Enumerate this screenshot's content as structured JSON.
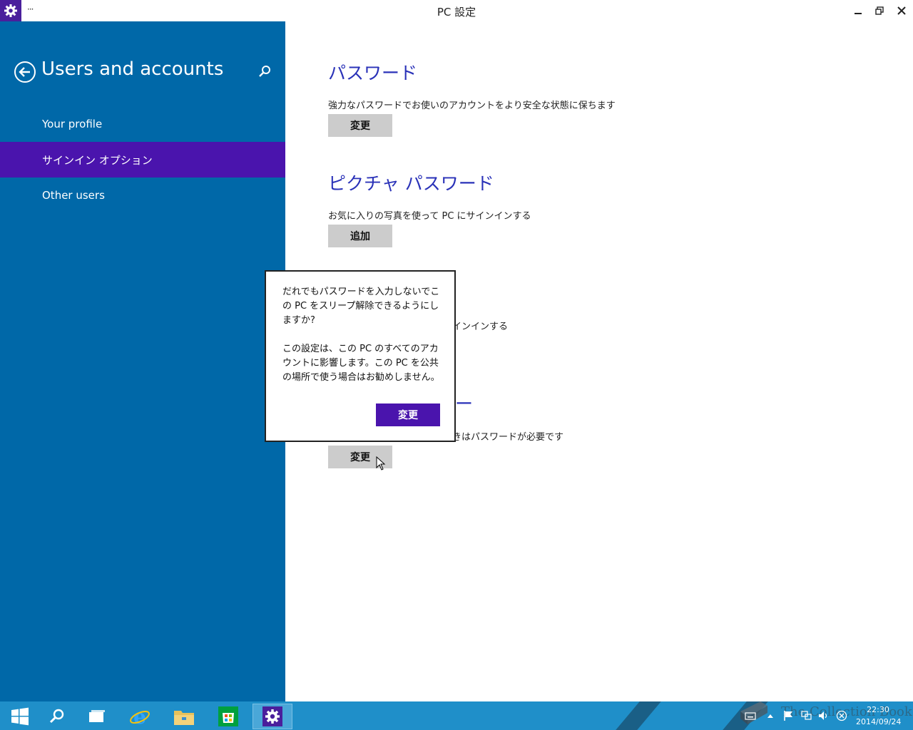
{
  "window": {
    "title": "PC 設定",
    "menu": "···",
    "icons": [
      "settings-gear-icon",
      "minimize-icon",
      "restore-icon",
      "close-icon"
    ]
  },
  "sidebar": {
    "title": "Users and accounts",
    "items": [
      {
        "label": "Your profile",
        "active": false
      },
      {
        "label": "サインイン オプション",
        "active": true
      },
      {
        "label": "Other users",
        "active": false
      }
    ]
  },
  "sections": {
    "password": {
      "title": "パスワード",
      "desc": "強力なパスワードでお使いのアカウントをより安全な状態に保ちます",
      "button": "変更"
    },
    "picture_password": {
      "title": "ピクチャ パスワード",
      "desc": "お気に入りの写真を使って PC にサインインする",
      "button": "追加"
    },
    "pin": {
      "desc_visible": "インインする"
    },
    "password_policy": {
      "title_visible": "ー",
      "desc_visible": "きはパスワードが必要です",
      "button": "変更"
    }
  },
  "flyout": {
    "question": "だれでもパスワードを入力しないでこの PC をスリープ解除できるようにしますか?",
    "note": "この設定は、この PC のすべてのアカウントに影響します。この PC を公共の場所で使う場合はお勧めしません。",
    "button": "変更"
  },
  "taskbar": {
    "items": [
      "start",
      "search",
      "task-view",
      "internet-explorer",
      "file-explorer",
      "store",
      "pc-settings"
    ],
    "active": "pc-settings",
    "time": "22:30",
    "date": "2014/09/24",
    "watermark": "The Collection Book"
  },
  "colors": {
    "sidebar_bg": "#0068a8",
    "active_item": "#4a14ad",
    "heading": "#2a32b8",
    "taskbar": "#1f8fc9"
  }
}
